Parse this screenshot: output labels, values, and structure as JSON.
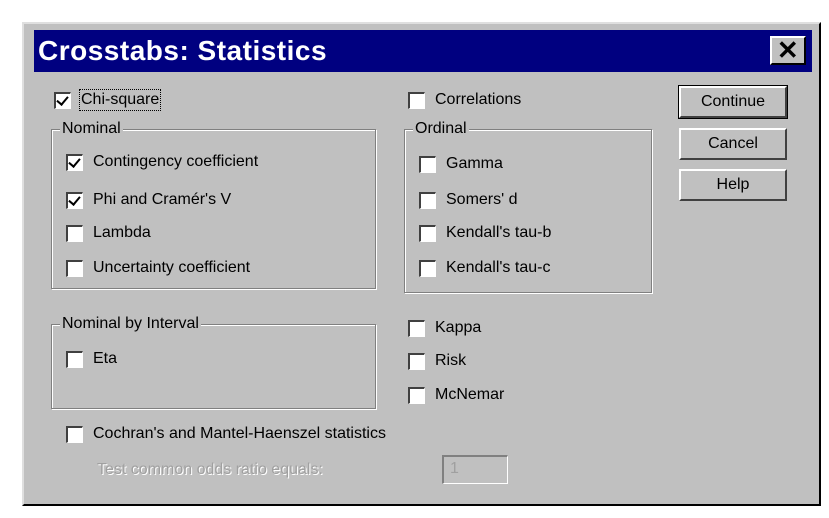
{
  "dialog": {
    "title": "Crosstabs: Statistics",
    "close_label": "✕"
  },
  "checks": {
    "chi_square": {
      "label": "Chi-square",
      "checked": true
    },
    "correlations": {
      "label": "Correlations",
      "checked": false
    },
    "contingency": {
      "label": "Contingency coefficient",
      "checked": true
    },
    "phi": {
      "label": "Phi and Cramér's V",
      "checked": true
    },
    "lambda": {
      "label": "Lambda",
      "checked": false
    },
    "uncertainty": {
      "label": "Uncertainty coefficient",
      "checked": false
    },
    "gamma": {
      "label": "Gamma",
      "checked": false
    },
    "somers": {
      "label": "Somers' d",
      "checked": false
    },
    "tau_b": {
      "label": "Kendall's tau-b",
      "checked": false
    },
    "tau_c": {
      "label": "Kendall's tau-c",
      "checked": false
    },
    "eta": {
      "label": "Eta",
      "checked": false
    },
    "kappa": {
      "label": "Kappa",
      "checked": false
    },
    "risk": {
      "label": "Risk",
      "checked": false
    },
    "mcnemar": {
      "label": "McNemar",
      "checked": false
    },
    "cochran": {
      "label": "Cochran's and Mantel-Haenszel statistics",
      "checked": false
    }
  },
  "groups": {
    "nominal": "Nominal",
    "ordinal": "Ordinal",
    "nominal_by_interval": "Nominal by Interval"
  },
  "buttons": {
    "continue": "Continue",
    "cancel": "Cancel",
    "help": "Help"
  },
  "odds": {
    "label": "Test common odds ratio equals:",
    "value": "1"
  }
}
